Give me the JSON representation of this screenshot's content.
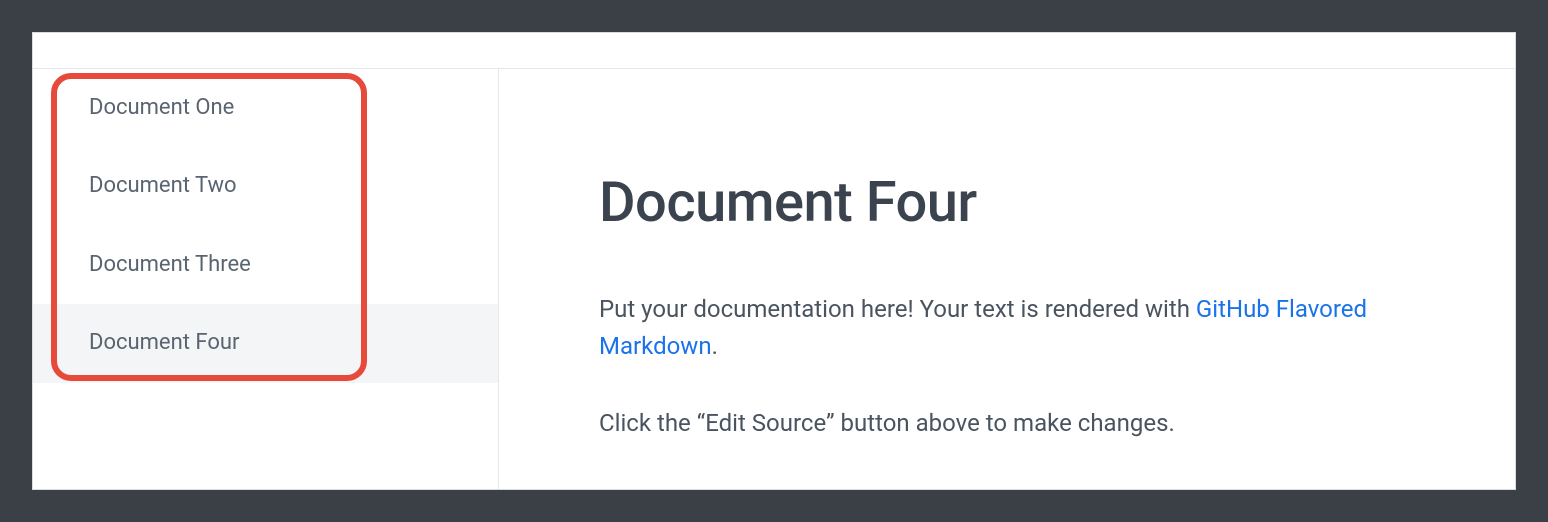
{
  "sidebar": {
    "items": [
      {
        "label": "Document One",
        "selected": false
      },
      {
        "label": "Document Two",
        "selected": false
      },
      {
        "label": "Document Three",
        "selected": false
      },
      {
        "label": "Document Four",
        "selected": true
      }
    ]
  },
  "content": {
    "title": "Document Four",
    "para1_prefix": "Put your documentation here! Your text is rendered with ",
    "para1_link": "GitHub Flavored Markdown",
    "para1_suffix": ".",
    "para2": "Click the “Edit Source” button above to make changes."
  }
}
